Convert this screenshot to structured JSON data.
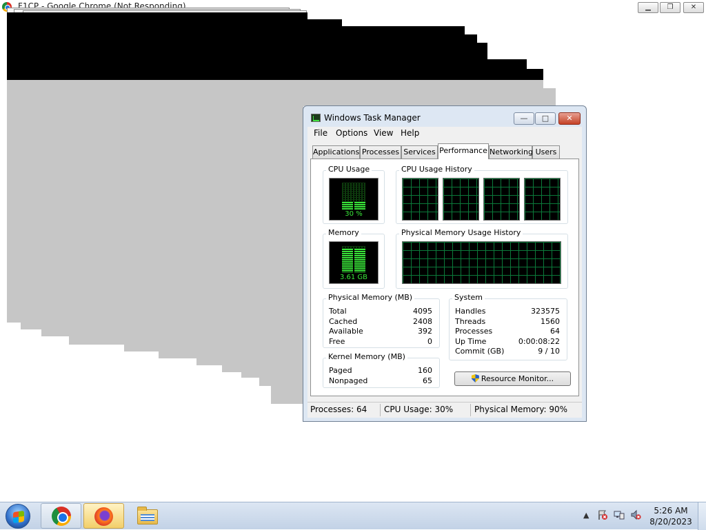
{
  "chrome": {
    "title": "F1CP - Google Chrome (Not Responding)",
    "minimize": "▁",
    "maximize": "❐",
    "close": "✕"
  },
  "task_manager": {
    "title": "Windows Task Manager",
    "caption": {
      "minimize": "—",
      "maximize": "□",
      "close": "✕"
    },
    "menu": [
      "File",
      "Options",
      "View",
      "Help"
    ],
    "tabs": [
      "Applications",
      "Processes",
      "Services",
      "Performance",
      "Networking",
      "Users"
    ],
    "active_tab": "Performance",
    "cpu_usage": {
      "label": "CPU Usage",
      "value_text": "30 %",
      "percent": 30
    },
    "cpu_history": {
      "label": "CPU Usage History",
      "graphs": 4
    },
    "memory": {
      "label": "Memory",
      "value_text": "3.61 GB",
      "fraction": 0.9
    },
    "memory_history": {
      "label": "Physical Memory Usage History"
    },
    "physical_memory": {
      "label": "Physical Memory (MB)",
      "rows": [
        {
          "name": "Total",
          "value": "4095"
        },
        {
          "name": "Cached",
          "value": "2408"
        },
        {
          "name": "Available",
          "value": "392"
        },
        {
          "name": "Free",
          "value": "0"
        }
      ]
    },
    "kernel_memory": {
      "label": "Kernel Memory (MB)",
      "rows": [
        {
          "name": "Paged",
          "value": "160"
        },
        {
          "name": "Nonpaged",
          "value": "65"
        }
      ]
    },
    "system": {
      "label": "System",
      "rows": [
        {
          "name": "Handles",
          "value": "323575"
        },
        {
          "name": "Threads",
          "value": "1560"
        },
        {
          "name": "Processes",
          "value": "64"
        },
        {
          "name": "Up Time",
          "value": "0:00:08:22"
        },
        {
          "name": "Commit (GB)",
          "value": "9 / 10"
        }
      ]
    },
    "resource_monitor_button": "Resource Monitor...",
    "status_bar": {
      "processes": "Processes: 64",
      "cpu": "CPU Usage: 30%",
      "memory": "Physical Memory: 90%"
    }
  },
  "taskbar": {
    "apps": [
      "chrome-icon",
      "firefox-icon",
      "file-explorer-icon"
    ],
    "active_app": "firefox-icon",
    "tray": {
      "show_hidden": "▲"
    },
    "clock": {
      "time": "5:26 AM",
      "date": "8/20/2023"
    }
  }
}
